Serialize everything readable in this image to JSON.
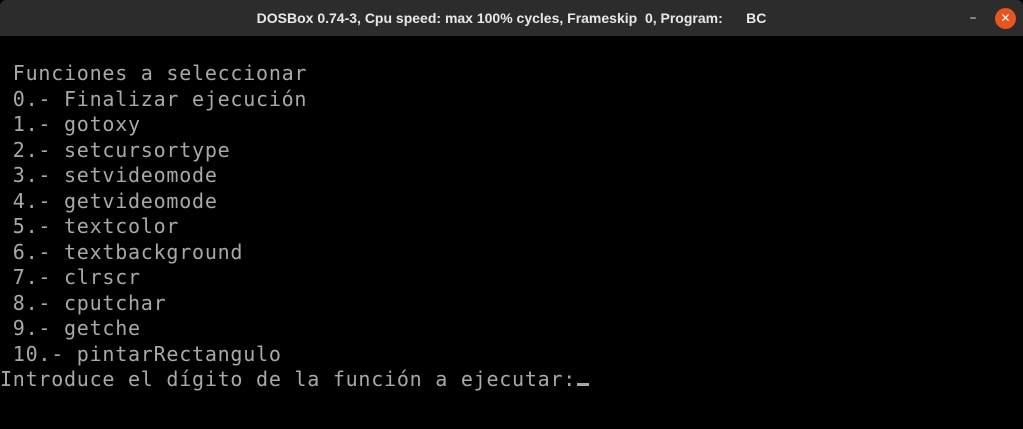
{
  "window": {
    "title": "DOSBox 0.74-3, Cpu speed: max 100% cycles, Frameskip  0, Program:      BC",
    "minimize_icon": "minimize-icon",
    "close_icon": "close-icon",
    "minimize_glyph": "–",
    "close_glyph": "✕"
  },
  "terminal": {
    "lines": [
      " Funciones a seleccionar",
      " 0.- Finalizar ejecución",
      " 1.- gotoxy",
      " 2.- setcursortype",
      " 3.- setvideomode",
      " 4.- getvideomode",
      " 5.- textcolor",
      " 6.- textbackground",
      " 7.- clrscr",
      " 8.- cputchar",
      " 9.- getche",
      " 10.- pintarRectangulo"
    ],
    "prompt": "Introduce el dígito de la función a ejecutar:"
  }
}
